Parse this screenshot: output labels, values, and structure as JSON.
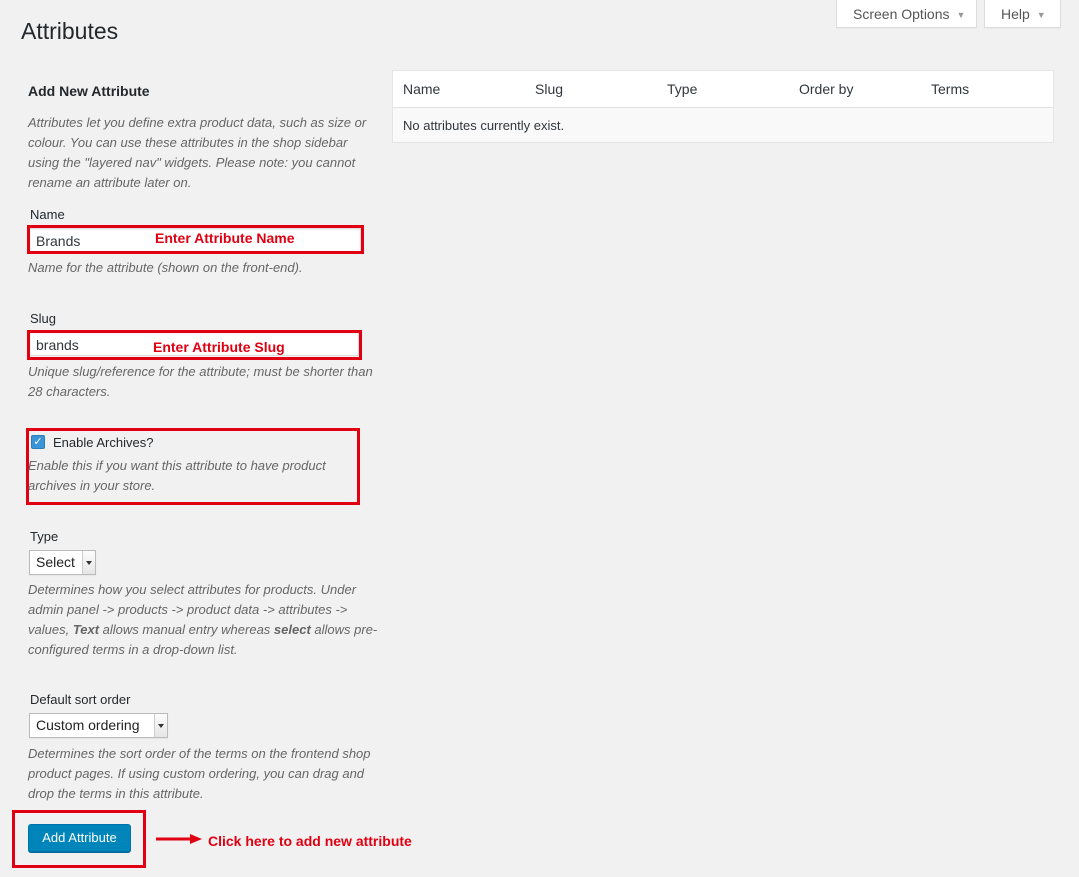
{
  "header": {
    "screen_options": "Screen Options",
    "help": "Help",
    "caret": "▼"
  },
  "page_title": "Attributes",
  "form": {
    "title": "Add New Attribute",
    "intro": "Attributes let you define extra product data, such as size or colour. You can use these attributes in the shop sidebar using the \"layered nav\" widgets. Please note: you cannot rename an attribute later on.",
    "name": {
      "label": "Name",
      "value": "Brands",
      "help": "Name for the attribute (shown on the front-end).",
      "annotation": "Enter Attribute Name"
    },
    "slug": {
      "label": "Slug",
      "value": "brands",
      "help": "Unique slug/reference for the attribute; must be shorter than 28 characters.",
      "annotation": "Enter Attribute Slug"
    },
    "archives": {
      "label": "Enable Archives?",
      "checked": true,
      "help": "Enable this if you want this attribute to have product archives in your store."
    },
    "type": {
      "label": "Type",
      "selected": "Select",
      "help_part1": "Determines how you select attributes for products. Under admin panel -> products -> product data -> attributes -> values, ",
      "help_bold1": "Text",
      "help_part2": " allows manual entry whereas ",
      "help_bold2": "select",
      "help_part3": " allows pre-configured terms in a drop-down list."
    },
    "sort_order": {
      "label": "Default sort order",
      "selected": "Custom ordering",
      "help": "Determines the sort order of the terms on the frontend shop product pages. If using custom ordering, you can drag and drop the terms in this attribute."
    },
    "submit_label": "Add Attribute",
    "submit_annotation": "Click here to add new attribute"
  },
  "table": {
    "columns": [
      "Name",
      "Slug",
      "Type",
      "Order by",
      "Terms"
    ],
    "empty_message": "No attributes currently exist."
  },
  "colors": {
    "annotation_red": "#e00012",
    "primary_blue": "#0085ba",
    "background": "#f1f1f1"
  }
}
